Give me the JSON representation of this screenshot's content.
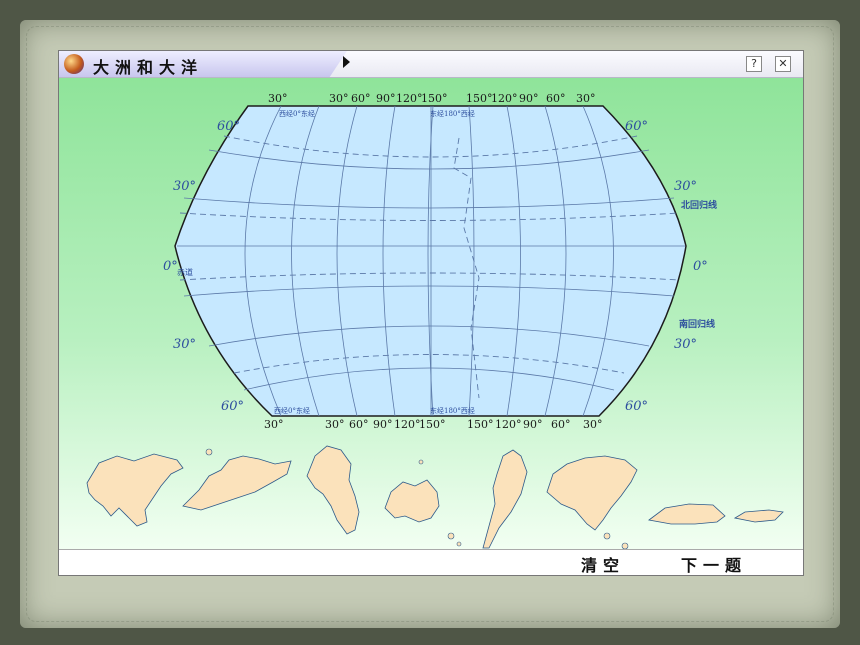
{
  "window": {
    "title": "大洲和大洋",
    "help_icon": "question-icon",
    "close_icon": "close-icon"
  },
  "map": {
    "top_longitudes": [
      "30°",
      "30°",
      "60°",
      "90°",
      "120°",
      "150°",
      "150°",
      "120°",
      "90°",
      "60°",
      "30°"
    ],
    "bottom_longitudes": [
      "30°",
      "30°",
      "60°",
      "90°",
      "120°",
      "150°",
      "150°",
      "120°",
      "90°",
      "60°",
      "30°"
    ],
    "top_meridian_labels": {
      "left": "西经0°东经",
      "center": "东经180°西经"
    },
    "bottom_meridian_labels": {
      "left": "西经0°东经",
      "center": "东经180°西经"
    },
    "latitudes_left": {
      "n60": "60°",
      "n30": "30°",
      "eq": "0°",
      "s30": "30°",
      "s60": "60°"
    },
    "latitudes_right": {
      "n60": "60°",
      "n30": "30°",
      "eq": "0°",
      "s30": "30°",
      "s60": "60°"
    },
    "lines": {
      "tropic_cancer": "北回归线",
      "equator": "赤道",
      "tropic_capricorn": "南回归线"
    },
    "colors": {
      "ocean": "#c6e8ff",
      "land": "#fbe2bb",
      "grid": "#5b79a8",
      "label": "#2e4f9e"
    }
  },
  "continents": [
    "asia",
    "europe",
    "africa",
    "oceania",
    "south-america",
    "north-america",
    "antarctica"
  ],
  "buttons": {
    "clear": "清空",
    "next": "下一题"
  }
}
